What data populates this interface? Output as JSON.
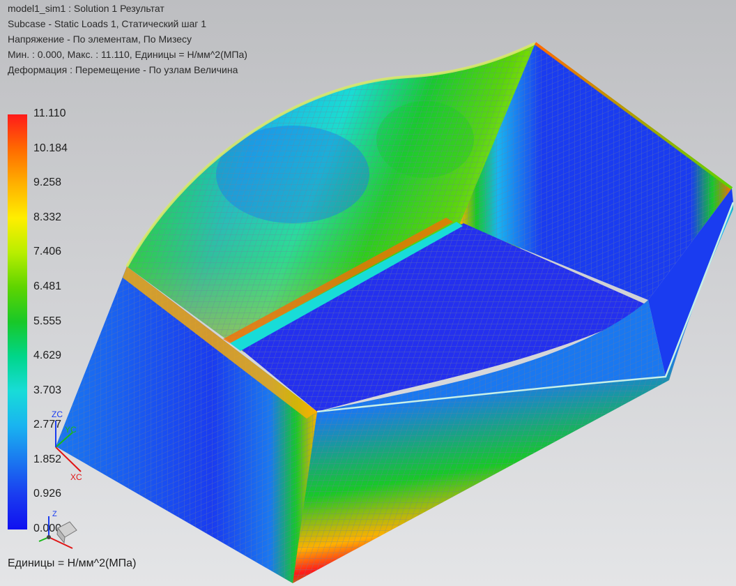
{
  "header": {
    "lines": [
      "model1_sim1 : Solution 1 Результат",
      "Subcase - Static Loads 1, Статический шаг 1",
      "Напряжение - По элементам, По Мизесу",
      "Мин. : 0.000, Макс. : 11.110, Единицы = Н/мм^2(МПа)",
      "Деформация : Перемещение - По узлам Величина"
    ]
  },
  "legend": {
    "ticks": [
      "11.110",
      "10.184",
      "9.258",
      "8.332",
      "7.406",
      "6.481",
      "5.555",
      "4.629",
      "3.703",
      "2.777",
      "1.852",
      "0.926",
      "0.000"
    ],
    "colors": [
      "#ff1a1a",
      "#ff6a00",
      "#ffb000",
      "#ffee00",
      "#b8ee00",
      "#5ed400",
      "#18c828",
      "#00d68a",
      "#18dcd8",
      "#19b4f0",
      "#1a78f0",
      "#1a3cf0",
      "#1010f0"
    ],
    "units": "Единицы = Н/мм^2(МПа)"
  },
  "triad": {
    "zc": "ZC",
    "yc": "YC",
    "xc": "XC",
    "z": "Z"
  },
  "theme": {
    "mesh_line": "#6e7ea0",
    "base_blue": "#1f3fd6"
  }
}
